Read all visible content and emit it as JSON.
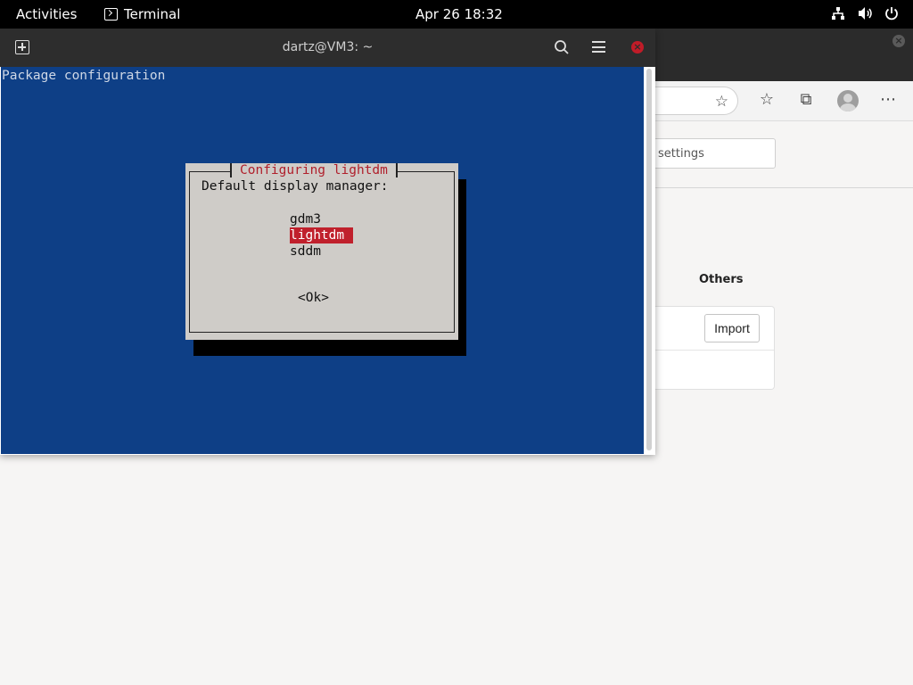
{
  "topbar": {
    "activities": "Activities",
    "app_name": "Terminal",
    "clock": "Apr 26  18:32",
    "tray_icons": [
      "network-icon",
      "volume-icon",
      "power-icon"
    ]
  },
  "terminal": {
    "title": "dartz@VM3: ~",
    "screen_header": "Package configuration",
    "dialog": {
      "title": "Configuring lightdm",
      "prompt": "Default display manager:",
      "options": [
        "gdm3",
        "lightdm",
        "sddm"
      ],
      "selected": "lightdm",
      "ok_label": "<Ok>"
    },
    "colors": {
      "background": "#0e3f86",
      "dialog_bg": "#cfccc8",
      "title_text": "#b0202c",
      "selection": "#c0202c"
    }
  },
  "browser": {
    "search_placeholder": "settings",
    "section_heading": "Others",
    "import_label": "Import"
  }
}
